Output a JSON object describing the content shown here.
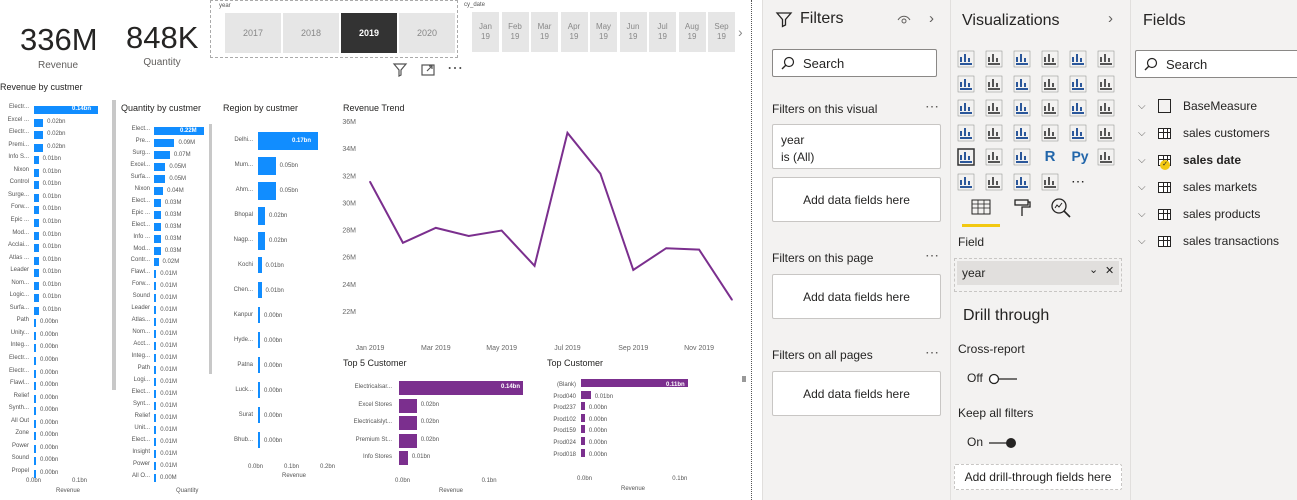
{
  "kpi": {
    "revenue_value": "336M",
    "revenue_label": "Revenue",
    "quantity_value": "848K",
    "quantity_label": "Quantity"
  },
  "year_slicer": {
    "title": "year",
    "items": [
      "2017",
      "2018",
      "2019",
      "2020"
    ],
    "selected": "2019"
  },
  "month_slicer": {
    "title": "cy_date",
    "items": [
      {
        "m": "Jan",
        "y": "19"
      },
      {
        "m": "Feb",
        "y": "19"
      },
      {
        "m": "Mar",
        "y": "19"
      },
      {
        "m": "Apr",
        "y": "19"
      },
      {
        "m": "May",
        "y": "19"
      },
      {
        "m": "Jun",
        "y": "19"
      },
      {
        "m": "Jul",
        "y": "19"
      },
      {
        "m": "Aug",
        "y": "19"
      },
      {
        "m": "Sep",
        "y": "19"
      }
    ],
    "next_arrow": "›"
  },
  "visual_header": {
    "filter_icon": "filter-icon",
    "focus_icon": "focus-mode-icon",
    "more": "⋯"
  },
  "rev_by_customer": {
    "title": "Revenue by custmer",
    "xlabel": "Revenue",
    "ticks": [
      "0.0bn",
      "0.1bn"
    ],
    "items": [
      {
        "n": "Electr...",
        "v": "0.14bn"
      },
      {
        "n": "Excel ...",
        "v": "0.02bn"
      },
      {
        "n": "Electr...",
        "v": "0.02bn"
      },
      {
        "n": "Premi...",
        "v": "0.02bn"
      },
      {
        "n": "Info S...",
        "v": "0.01bn"
      },
      {
        "n": "Nixon",
        "v": "0.01bn"
      },
      {
        "n": "Control",
        "v": "0.01bn"
      },
      {
        "n": "Surge...",
        "v": "0.01bn"
      },
      {
        "n": "Forw...",
        "v": "0.01bn"
      },
      {
        "n": "Epic ...",
        "v": "0.01bn"
      },
      {
        "n": "Mod...",
        "v": "0.01bn"
      },
      {
        "n": "Acclai...",
        "v": "0.01bn"
      },
      {
        "n": "Atlas ...",
        "v": "0.01bn"
      },
      {
        "n": "Leader",
        "v": "0.01bn"
      },
      {
        "n": "Nom...",
        "v": "0.01bn"
      },
      {
        "n": "Logic...",
        "v": "0.01bn"
      },
      {
        "n": "Surfa...",
        "v": "0.01bn"
      },
      {
        "n": "Path",
        "v": "0.00bn"
      },
      {
        "n": "Unity...",
        "v": "0.00bn"
      },
      {
        "n": "Integ...",
        "v": "0.00bn"
      },
      {
        "n": "Electr...",
        "v": "0.00bn"
      },
      {
        "n": "Electr...",
        "v": "0.00bn"
      },
      {
        "n": "Flawl...",
        "v": "0.00bn"
      },
      {
        "n": "Relief",
        "v": "0.00bn"
      },
      {
        "n": "Synth...",
        "v": "0.00bn"
      },
      {
        "n": "All Out",
        "v": "0.00bn"
      },
      {
        "n": "Zone",
        "v": "0.00bn"
      },
      {
        "n": "Power",
        "v": "0.00bn"
      },
      {
        "n": "Sound",
        "v": "0.00bn"
      },
      {
        "n": "Propel",
        "v": "0.00bn"
      }
    ]
  },
  "qty_by_customer": {
    "title": "Quantity by custmer",
    "xlabel": "Quantity",
    "items": [
      {
        "n": "Elect...",
        "v": "0.22M"
      },
      {
        "n": "Pre...",
        "v": "0.09M"
      },
      {
        "n": "Surg...",
        "v": "0.07M"
      },
      {
        "n": "Excel...",
        "v": "0.05M"
      },
      {
        "n": "Surfa...",
        "v": "0.05M"
      },
      {
        "n": "Nixon",
        "v": "0.04M"
      },
      {
        "n": "Elect...",
        "v": "0.03M"
      },
      {
        "n": "Epic ...",
        "v": "0.03M"
      },
      {
        "n": "Elect...",
        "v": "0.03M"
      },
      {
        "n": "Info ...",
        "v": "0.03M"
      },
      {
        "n": "Mod...",
        "v": "0.03M"
      },
      {
        "n": "Contr...",
        "v": "0.02M"
      },
      {
        "n": "Flawl...",
        "v": "0.01M"
      },
      {
        "n": "Forw...",
        "v": "0.01M"
      },
      {
        "n": "Sound",
        "v": "0.01M"
      },
      {
        "n": "Leader",
        "v": "0.01M"
      },
      {
        "n": "Atlas...",
        "v": "0.01M"
      },
      {
        "n": "Nom...",
        "v": "0.01M"
      },
      {
        "n": "Acct...",
        "v": "0.01M"
      },
      {
        "n": "Integ...",
        "v": "0.01M"
      },
      {
        "n": "Path",
        "v": "0.01M"
      },
      {
        "n": "Logi...",
        "v": "0.01M"
      },
      {
        "n": "Elect...",
        "v": "0.01M"
      },
      {
        "n": "Synt...",
        "v": "0.01M"
      },
      {
        "n": "Relief",
        "v": "0.01M"
      },
      {
        "n": "Unit...",
        "v": "0.01M"
      },
      {
        "n": "Elect...",
        "v": "0.01M"
      },
      {
        "n": "Insight",
        "v": "0.01M"
      },
      {
        "n": "Power",
        "v": "0.01M"
      },
      {
        "n": "All O...",
        "v": "0.00M"
      }
    ]
  },
  "region_by_customer": {
    "title": "Region by custmer",
    "xlabel": "Revenue",
    "ticks": [
      "0.0bn",
      "0.1bn",
      "0.2bn"
    ],
    "items": [
      {
        "n": "Delhi...",
        "v": "0.17bn",
        "x": 0.17
      },
      {
        "n": "Mum...",
        "v": "0.05bn",
        "x": 0.05
      },
      {
        "n": "Ahm...",
        "v": "0.05bn",
        "x": 0.05
      },
      {
        "n": "Bhopal",
        "v": "0.02bn",
        "x": 0.02
      },
      {
        "n": "Nagp...",
        "v": "0.02bn",
        "x": 0.02
      },
      {
        "n": "Kochi",
        "v": "0.01bn",
        "x": 0.01
      },
      {
        "n": "Chen...",
        "v": "0.01bn",
        "x": 0.01
      },
      {
        "n": "Kanpur",
        "v": "0.00bn",
        "x": 0.003
      },
      {
        "n": "Hyde...",
        "v": "0.00bn",
        "x": 0.002
      },
      {
        "n": "Patna",
        "v": "0.00bn",
        "x": 0.002
      },
      {
        "n": "Luck...",
        "v": "0.00bn",
        "x": 0.001
      },
      {
        "n": "Surat",
        "v": "0.00bn",
        "x": 0.001
      },
      {
        "n": "Bhub...",
        "v": "0.00bn",
        "x": 0.001
      }
    ]
  },
  "chart_data": [
    {
      "type": "line",
      "title": "Revenue Trend",
      "x": [
        "Jan 2019",
        "Feb 2019",
        "Mar 2019",
        "Apr 2019",
        "May 2019",
        "Jun 2019",
        "Jul 2019",
        "Aug 2019",
        "Sep 2019",
        "Oct 2019",
        "Nov 2019",
        "Dec 2019"
      ],
      "xticks": [
        "Jan 2019",
        "Mar 2019",
        "May 2019",
        "Jul 2019",
        "Sep 2019",
        "Nov 2019"
      ],
      "yticks": [
        "22M",
        "24M",
        "26M",
        "28M",
        "30M",
        "32M",
        "34M",
        "36M"
      ],
      "values": [
        31.6,
        27.1,
        28.2,
        27.6,
        28.0,
        25.4,
        35.2,
        32.2,
        25.1,
        26.7,
        26.6,
        22.9
      ],
      "ylim": [
        22,
        36
      ],
      "color": "#7b2f8e"
    },
    {
      "type": "bar",
      "title": "Top 5 Customer",
      "xlabel": "Revenue",
      "ticks": [
        "0.0bn",
        "0.1bn"
      ],
      "categories": [
        "Electricalsar...",
        "Excel Stores",
        "Electricalslyt...",
        "Premium St...",
        "Info Stores"
      ],
      "labels": [
        "0.14bn",
        "0.02bn",
        "0.02bn",
        "0.02bn",
        "0.01bn"
      ],
      "values": [
        0.14,
        0.02,
        0.02,
        0.02,
        0.01
      ],
      "xlim": [
        0,
        0.14
      ]
    },
    {
      "type": "bar",
      "title": "Top Customer",
      "xlabel": "Revenue",
      "ticks": [
        "0.0bn",
        "0.1bn"
      ],
      "categories": [
        "(Blank)",
        "Prod040",
        "Prod237",
        "Prod102",
        "Prod159",
        "Prod024",
        "Prod018"
      ],
      "labels": [
        "0.11bn",
        "0.01bn",
        "0.00bn",
        "0.00bn",
        "0.00bn",
        "0.00bn",
        "0.00bn"
      ],
      "values": [
        0.11,
        0.01,
        0.004,
        0.004,
        0.004,
        0.004,
        0.004
      ],
      "xlim": [
        0,
        0.11
      ]
    }
  ],
  "filters": {
    "title": "Filters",
    "search_placeholder": "Search",
    "on_visual": "Filters on this visual",
    "visual_filter_line1": "year",
    "visual_filter_line2": "is (All)",
    "add_fields": "Add data fields here",
    "on_page": "Filters on this page",
    "on_all": "Filters on all pages",
    "more": "⋯"
  },
  "visualizations": {
    "title": "Visualizations",
    "field_label": "Field",
    "field_value": "year",
    "drill_title": "Drill through",
    "cross_report": "Cross-report",
    "cross_state": "Off",
    "keep_filters": "Keep all filters",
    "keep_state": "On",
    "add_drill": "Add drill-through fields here",
    "r_label": "R",
    "py_label": "Py",
    "more": "⋯"
  },
  "fields": {
    "title": "Fields",
    "search_placeholder": "Search",
    "items": [
      "BaseMeasure",
      "sales customers",
      "sales date",
      "sales markets",
      "sales products",
      "sales transactions"
    ]
  },
  "colors": {
    "blue": "#118dff",
    "purple": "#7b2f8e",
    "accent": "#f2c811"
  }
}
